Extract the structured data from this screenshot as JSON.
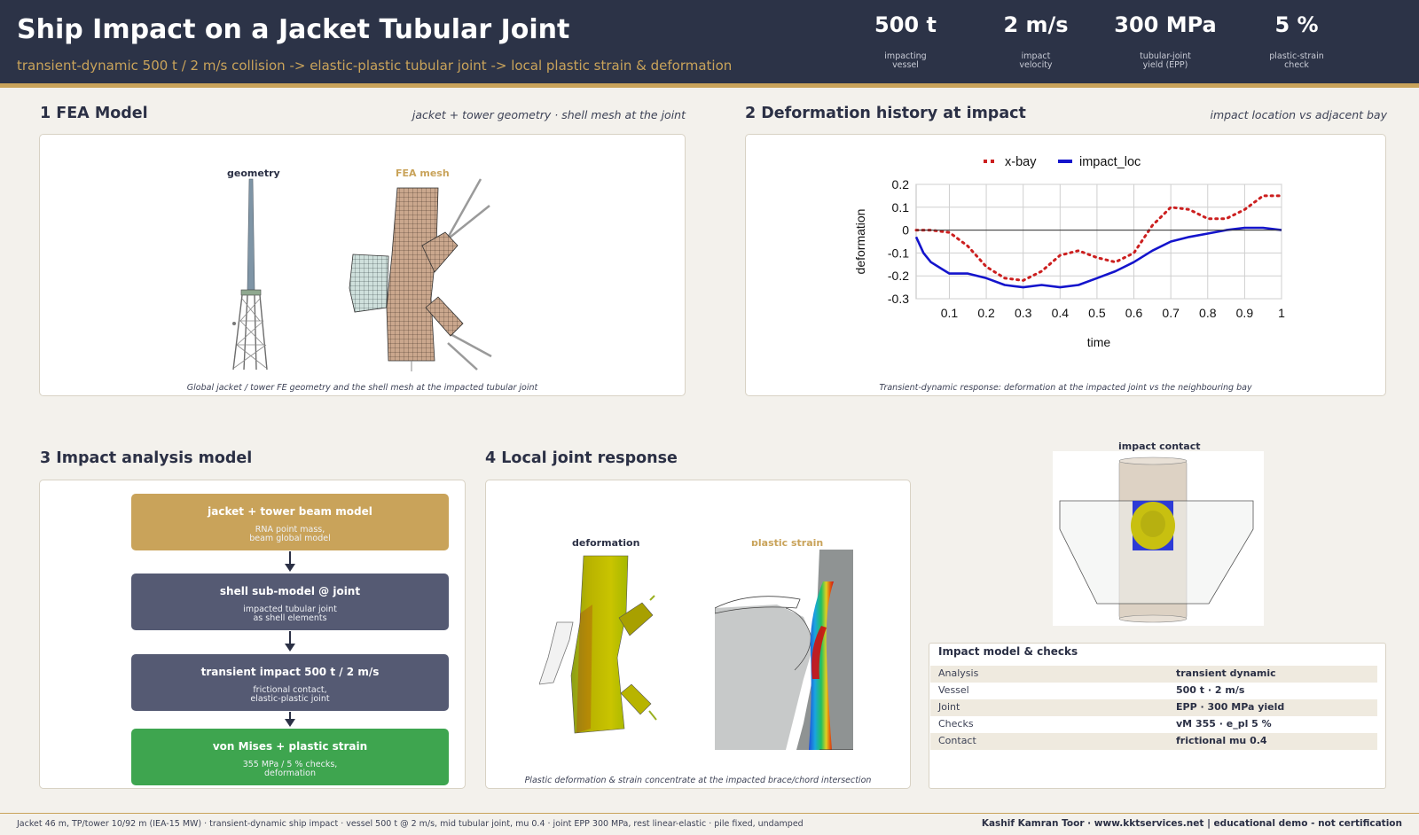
{
  "header": {
    "title": "Ship Impact on a Jacket Tubular Joint",
    "subtitle": "transient-dynamic 500 t / 2 m/s collision -> elastic-plastic tubular joint -> local plastic strain & deformation",
    "kpis": [
      {
        "value": "500 t",
        "label": "impacting\nvessel"
      },
      {
        "value": "2 m/s",
        "label": "impact\nvelocity"
      },
      {
        "value": "300 MPa",
        "label": "tubular-joint\nyield (EPP)"
      },
      {
        "value": "5 %",
        "label": "plastic-strain\ncheck"
      }
    ]
  },
  "sections": {
    "fea": {
      "title": "1  FEA Model",
      "note": "jacket + tower geometry  ·  shell mesh at the joint",
      "label_geometry": "geometry",
      "label_mesh": "FEA mesh",
      "caption": "Global jacket / tower FE geometry and the shell mesh at the impacted tubular joint"
    },
    "history": {
      "title": "2  Deformation history at impact",
      "note": "impact location vs adjacent bay",
      "caption": "Transient-dynamic response: deformation at the impacted joint vs the neighbouring bay"
    },
    "impact": {
      "title": "3  Impact analysis model"
    },
    "local": {
      "title": "4  Local joint response",
      "label_deformation": "deformation",
      "label_strain": "plastic strain",
      "caption": "Plastic deformation & strain concentrate at the impacted brace/chord intersection"
    },
    "contact": {
      "label": "impact contact"
    }
  },
  "flow": [
    {
      "title": "jacket + tower beam model",
      "sub": "RNA point mass,\nbeam global model"
    },
    {
      "title": "shell sub-model @ joint",
      "sub": "impacted tubular joint\nas shell elements"
    },
    {
      "title": "transient impact 500 t / 2 m/s",
      "sub": "frictional contact,\nelastic-plastic joint"
    },
    {
      "title": "von Mises + plastic strain",
      "sub": "355 MPa / 5 % checks,\ndeformation"
    }
  ],
  "checks": {
    "title": "Impact model & checks",
    "rows": [
      {
        "key": "Analysis",
        "value": "transient dynamic"
      },
      {
        "key": "Vessel",
        "value": "500 t · 2 m/s"
      },
      {
        "key": "Joint",
        "value": "EPP · 300 MPa yield"
      },
      {
        "key": "Checks",
        "value": "vM 355 · e_pl 5 %"
      },
      {
        "key": "Contact",
        "value": "frictional mu 0.4"
      }
    ]
  },
  "footer": {
    "left": "Jacket 46 m, TP/tower 10/92 m (IEA-15 MW)  ·  transient-dynamic ship impact  ·  vessel 500 t @ 2 m/s, mid tubular joint, mu 0.4  ·  joint EPP 300 MPa, rest linear-elastic  ·  pile fixed, undamped",
    "right": "Kashif Kamran Toor  ·  www.kktservices.net   |   educational demo - not certification"
  },
  "chart_data": {
    "type": "line",
    "xlabel": "time",
    "ylabel": "deformation",
    "xlim": [
      0.01,
      1.0
    ],
    "ylim": [
      -0.3,
      0.2
    ],
    "xticks": [
      0.1,
      0.2,
      0.3,
      0.4,
      0.5,
      0.6,
      0.7,
      0.8,
      0.9,
      1
    ],
    "xtick_labels": [
      "0.1",
      "0.2",
      "0.3",
      "0.4",
      "0.5",
      "0.6",
      "0.7",
      "0.8",
      "0.9",
      "1"
    ],
    "yticks": [
      0.2,
      0.1,
      0,
      -0.1,
      -0.2,
      -0.3
    ],
    "ytick_labels": [
      "0.2",
      "0.1",
      "0",
      "-0.1",
      "-0.2",
      "-0.3"
    ],
    "grid": true,
    "legend": "top",
    "series": [
      {
        "name": "x-bay",
        "color": "#cc1f1f",
        "style": "dotted",
        "x": [
          0.01,
          0.05,
          0.1,
          0.15,
          0.2,
          0.25,
          0.3,
          0.35,
          0.4,
          0.45,
          0.5,
          0.55,
          0.6,
          0.65,
          0.7,
          0.75,
          0.8,
          0.85,
          0.9,
          0.95,
          1.0
        ],
        "y": [
          0.0,
          0.0,
          -0.01,
          -0.07,
          -0.16,
          -0.21,
          -0.22,
          -0.18,
          -0.11,
          -0.09,
          -0.12,
          -0.14,
          -0.1,
          0.02,
          0.1,
          0.09,
          0.05,
          0.05,
          0.09,
          0.15,
          0.15
        ]
      },
      {
        "name": "impact_loc",
        "color": "#1414cc",
        "style": "solid",
        "x": [
          0.01,
          0.03,
          0.05,
          0.08,
          0.1,
          0.15,
          0.2,
          0.25,
          0.3,
          0.35,
          0.4,
          0.45,
          0.5,
          0.55,
          0.6,
          0.65,
          0.7,
          0.75,
          0.8,
          0.85,
          0.9,
          0.95,
          1.0
        ],
        "y": [
          -0.03,
          -0.1,
          -0.14,
          -0.17,
          -0.19,
          -0.19,
          -0.21,
          -0.24,
          -0.25,
          -0.24,
          -0.25,
          -0.24,
          -0.21,
          -0.18,
          -0.14,
          -0.09,
          -0.05,
          -0.03,
          -0.015,
          0.0,
          0.01,
          0.01,
          0.0
        ]
      }
    ]
  }
}
